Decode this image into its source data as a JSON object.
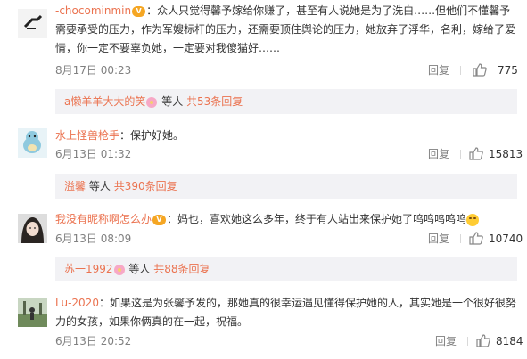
{
  "comments": [
    {
      "username": "-chocominmin",
      "text": "：众人只觉得馨予嫁给你赚了，甚至有人说她是为了洗白……但他们不懂馨予需要承受的压力，作为军嫂标杆的压力，还需要顶住舆论的压力，她放弃了浮华，名利，嫁给了爱情，你一定不要辜负她，一定要对我傻猫好……",
      "time": "8月17日 00:23",
      "reply_label": "回复",
      "likes": "775",
      "sub_replies": {
        "user": "a懒羊羊大大的笑",
        "mid": "等人",
        "count_text": "共53条回复"
      }
    },
    {
      "username": "水上怪兽枪手",
      "text": "：保护好她。",
      "time": "6月13日 01:32",
      "reply_label": "回复",
      "likes": "15813",
      "sub_replies": {
        "user": "溢馨",
        "mid": "等人",
        "count_text": "共390条回复"
      }
    },
    {
      "username": "我没有昵称啊怎么办",
      "text": "：妈也，喜欢她这么多年，终于有人站出来保护她了呜呜呜呜呜",
      "time": "6月13日 08:09",
      "reply_label": "回复",
      "likes": "10740",
      "sub_replies": {
        "user": "苏一1992",
        "mid": "等人",
        "count_text": "共88条回复"
      }
    },
    {
      "username": "Lu-2020",
      "text": "：如果这是为张馨予发的，那她真的很幸运遇见懂得保护她的人，其实她是一个很好很努力的女孩，如果你俩真的在一起，祝福。",
      "time": "6月13日 20:52",
      "reply_label": "回复",
      "likes": "8184"
    }
  ],
  "colors": {
    "username": "#eb7350",
    "meta": "#808080",
    "subbar_bg": "#f2f2f5"
  },
  "icons": {
    "like": "thumbs-up-icon",
    "vip": "vip-badge-icon",
    "flower": "flower-icon",
    "cry": "crying-emoji-icon"
  }
}
